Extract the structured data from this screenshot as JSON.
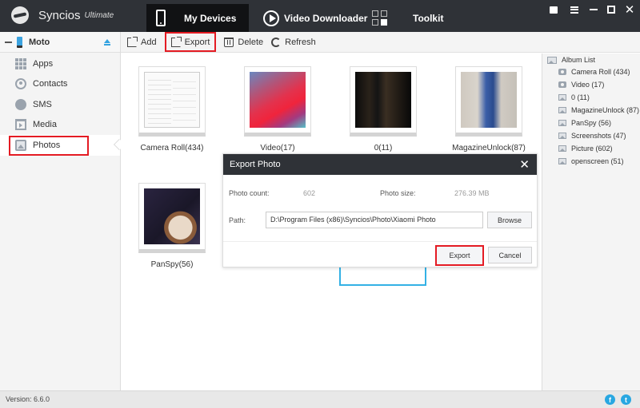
{
  "app": {
    "name": "Syncios",
    "edition": "Ultimate"
  },
  "nav": {
    "tabs": [
      {
        "label": "My Devices",
        "icon": "phone-icon",
        "active": true
      },
      {
        "label": "Video Downloader",
        "icon": "play-icon",
        "active": false
      },
      {
        "label": "Toolkit",
        "icon": "toolkit-grid-icon",
        "active": false
      }
    ]
  },
  "window_controls": [
    "feedback",
    "menu",
    "minimize",
    "maximize",
    "close"
  ],
  "sidebar": {
    "device": {
      "name": "Moto",
      "icon": "phone-icon"
    },
    "items": [
      {
        "label": "Apps",
        "icon": "apps-icon"
      },
      {
        "label": "Contacts",
        "icon": "contacts-icon"
      },
      {
        "label": "SMS",
        "icon": "sms-icon"
      },
      {
        "label": "Media",
        "icon": "media-icon"
      },
      {
        "label": "Photos",
        "icon": "photos-icon",
        "selected": true
      }
    ]
  },
  "toolbar": {
    "add": "Add",
    "export": "Export",
    "delete": "Delete",
    "refresh": "Refresh"
  },
  "albums": [
    {
      "label": "Camera Roll(434)"
    },
    {
      "label": "Video(17)"
    },
    {
      "label": "0(11)"
    },
    {
      "label": "MagazineUnlock(87)"
    },
    {
      "label": "PanSpy(56)"
    }
  ],
  "album_list": {
    "title": "Album List",
    "items": [
      {
        "label": "Camera Roll (434)",
        "icon": "camera-icon"
      },
      {
        "label": "Video (17)",
        "icon": "camera-icon"
      },
      {
        "label": "0 (11)",
        "icon": "picture-icon"
      },
      {
        "label": "MagazineUnlock (87)",
        "icon": "picture-icon"
      },
      {
        "label": "PanSpy (56)",
        "icon": "picture-icon"
      },
      {
        "label": "Screenshots (47)",
        "icon": "picture-icon"
      },
      {
        "label": "Picture (602)",
        "icon": "picture-icon"
      },
      {
        "label": "openscreen (51)",
        "icon": "picture-icon"
      }
    ]
  },
  "dialog": {
    "title": "Export Photo",
    "photo_count_label": "Photo count:",
    "photo_count": "602",
    "photo_size_label": "Photo size:",
    "photo_size": "276.39 MB",
    "path_label": "Path:",
    "path_value": "D:\\Program Files (x86)\\Syncios\\Photo\\Xiaomi Photo",
    "browse": "Browse",
    "export": "Export",
    "cancel": "Cancel",
    "close": "✕"
  },
  "status": {
    "version": "Version: 6.6.0",
    "facebook": "f",
    "twitter": "t"
  },
  "colors": {
    "titlebar": "#2f3237",
    "accent_blue": "#29a7e1",
    "highlight_red": "#e41b23"
  }
}
